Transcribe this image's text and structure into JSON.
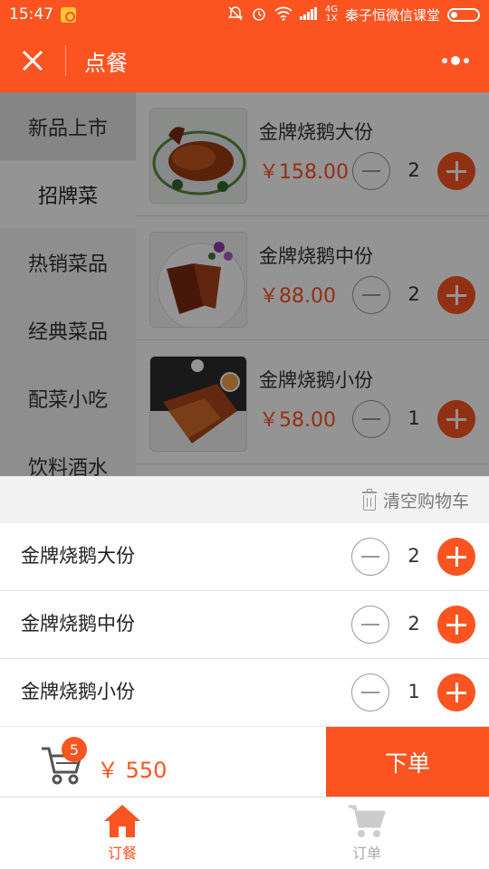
{
  "status_bar": {
    "time": "15:47",
    "network": "4G",
    "network_sub": "1X",
    "carrier": "秦子恒微信课堂"
  },
  "header": {
    "title": "点餐",
    "close_icon": "close-icon",
    "more_icon": "more-icon"
  },
  "categories": [
    {
      "label": "新品上市"
    },
    {
      "label": "招牌菜"
    },
    {
      "label": "热销菜品"
    },
    {
      "label": "经典菜品"
    },
    {
      "label": "配菜小吃"
    },
    {
      "label": "饮料酒水"
    }
  ],
  "active_category": "招牌菜",
  "menu_items": [
    {
      "name": "金牌烧鹅大份",
      "price": "￥158.00",
      "qty": "2"
    },
    {
      "name": "金牌烧鹅中份",
      "price": "￥88.00",
      "qty": "2"
    },
    {
      "name": "金牌烧鹅小份",
      "price": "￥58.00",
      "qty": "1"
    }
  ],
  "cart": {
    "clear_label": "清空购物车",
    "items": [
      {
        "name": "金牌烧鹅大份",
        "qty": "2"
      },
      {
        "name": "金牌烧鹅中份",
        "qty": "2"
      },
      {
        "name": "金牌烧鹅小份",
        "qty": "1"
      }
    ],
    "count": "5",
    "total": "￥ 550",
    "order_button": "下单"
  },
  "tabs": [
    {
      "label": "订餐",
      "icon": "home-icon",
      "active": true
    },
    {
      "label": "订单",
      "icon": "cart-icon",
      "active": false
    }
  ],
  "colors": {
    "accent": "#fb5421"
  }
}
